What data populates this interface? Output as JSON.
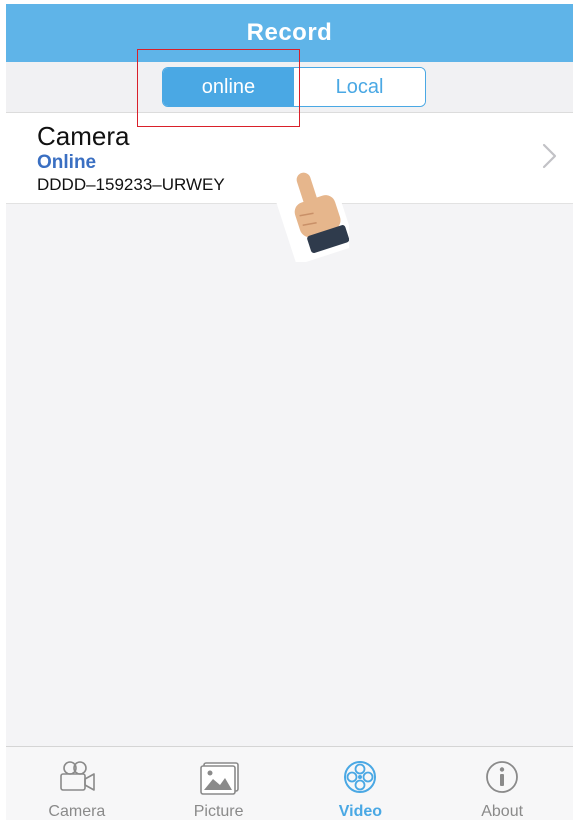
{
  "header": {
    "title": "Record"
  },
  "segment": {
    "options": [
      {
        "label": "online",
        "selected": true
      },
      {
        "label": "Local",
        "selected": false
      }
    ]
  },
  "device": {
    "name": "Camera",
    "status": "Online",
    "id": "DDDD–159233–URWEY"
  },
  "tabbar": {
    "items": [
      {
        "label": "Camera",
        "icon": "camera-icon",
        "active": false
      },
      {
        "label": "Picture",
        "icon": "picture-icon",
        "active": false
      },
      {
        "label": "Video",
        "icon": "video-icon",
        "active": true
      },
      {
        "label": "About",
        "icon": "info-icon",
        "active": false
      }
    ]
  },
  "colors": {
    "header": "#5fb4e8",
    "accent": "#4aa8e4",
    "status": "#3a6fc2",
    "highlight": "#d9202a"
  }
}
